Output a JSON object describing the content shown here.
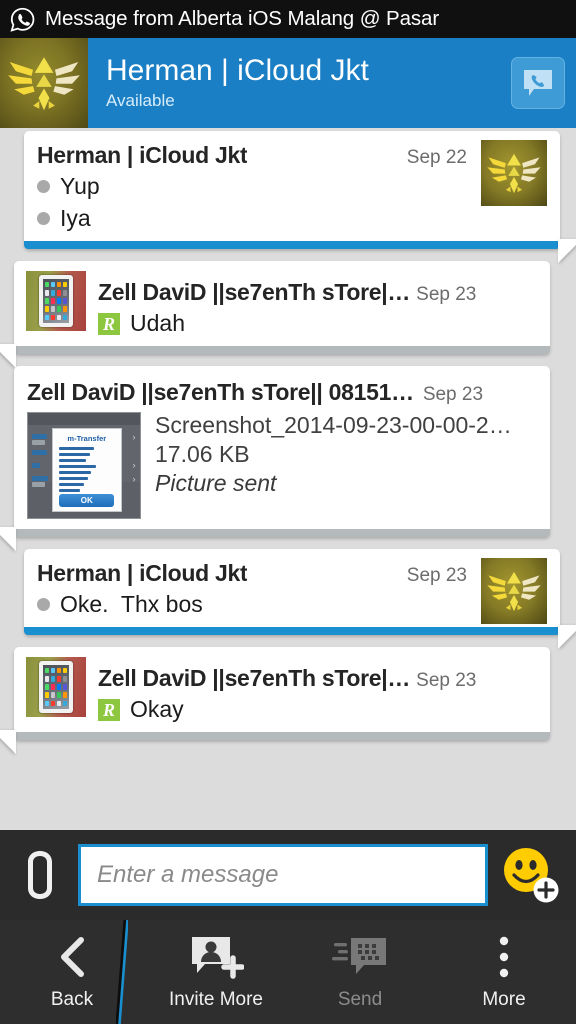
{
  "statusbar": {
    "icon": "whatsapp-icon",
    "text": "Message from Alberta iOS Malang @ Pasar"
  },
  "header": {
    "avatar_icon": "zelda-triforce-avatar",
    "name": "Herman | iCloud Jkt",
    "status": "Available",
    "call_button_icon": "phone-bubble-icon"
  },
  "messages": [
    {
      "direction": "incoming",
      "sender": "Herman | iCloud Jkt",
      "date": "Sep 22",
      "avatar_icon": "zelda-triforce-avatar",
      "lines": [
        "Yup",
        "Iya"
      ]
    },
    {
      "direction": "outgoing",
      "sender": "Zell DaviD ||se7enTh sTore|…",
      "date": "Sep 23",
      "avatar_icon": "ipad-photo-avatar",
      "status_badge": "R",
      "text": "Udah"
    },
    {
      "direction": "outgoing",
      "type": "picture",
      "sender": "Zell DaviD ||se7enTh sTore|| 08151…",
      "date": "Sep 23",
      "thumbnail_icon": "banking-screenshot-thumbnail",
      "thumbnail_title": "m-Transfer",
      "thumbnail_button": "OK",
      "file_name": "Screenshot_2014-09-23-00-00-2…",
      "file_size": "17.06 KB",
      "transfer_status": "Picture sent"
    },
    {
      "direction": "incoming",
      "sender": "Herman | iCloud Jkt",
      "date": "Sep 23",
      "avatar_icon": "zelda-triforce-avatar",
      "lines": [
        "Oke.  Thx bos"
      ]
    },
    {
      "direction": "outgoing",
      "sender": "Zell DaviD ||se7enTh sTore|…",
      "date": "Sep 23",
      "avatar_icon": "ipad-photo-avatar",
      "status_badge": "R",
      "text": "Okay"
    }
  ],
  "compose": {
    "attach_icon": "paperclip-icon",
    "placeholder": "Enter a message",
    "value": "",
    "emoji_icon": "smiley-plus-icon"
  },
  "navbar": {
    "items": [
      {
        "label": "Back",
        "icon": "chevron-left-icon",
        "enabled": true
      },
      {
        "label": "Invite More",
        "icon": "add-contact-icon",
        "enabled": true
      },
      {
        "label": "Send",
        "icon": "bbm-send-icon",
        "enabled": false
      },
      {
        "label": "More",
        "icon": "overflow-dots-icon",
        "enabled": true
      }
    ]
  },
  "colors": {
    "header_blue": "#1a7fc4",
    "accent_blue": "#1a8fd0",
    "list_bg": "#dcdcdc",
    "statusbar_bg": "#101010",
    "compose_bg": "#2b2b2b",
    "navbar_bg": "#2e2e2e",
    "read_badge_green": "#8dc63f"
  }
}
